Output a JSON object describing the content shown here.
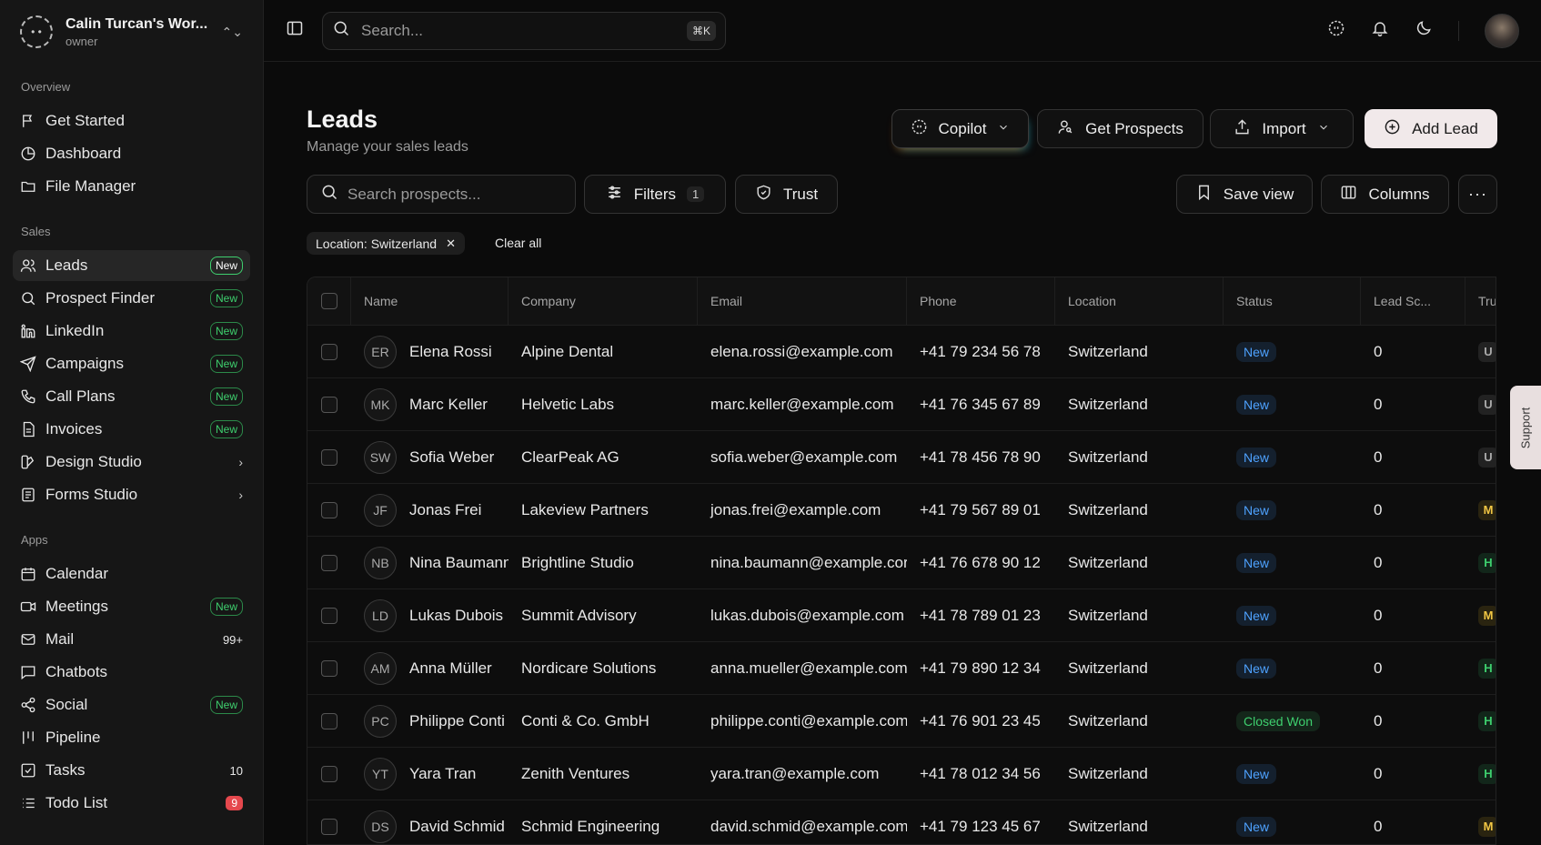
{
  "workspace": {
    "name": "Calin Turcan's Wor...",
    "role": "owner"
  },
  "sidebar": {
    "overview_label": "Overview",
    "overview": [
      {
        "label": "Get Started",
        "icon": "flag-icon"
      },
      {
        "label": "Dashboard",
        "icon": "pie-chart-icon"
      },
      {
        "label": "File Manager",
        "icon": "folder-icon"
      }
    ],
    "sales_label": "Sales",
    "sales": [
      {
        "label": "Leads",
        "badge": "New"
      },
      {
        "label": "Prospect Finder",
        "badge": "New"
      },
      {
        "label": "LinkedIn",
        "badge": "New"
      },
      {
        "label": "Campaigns",
        "badge": "New"
      },
      {
        "label": "Call Plans",
        "badge": "New"
      },
      {
        "label": "Invoices",
        "badge": "New"
      },
      {
        "label": "Design Studio"
      },
      {
        "label": "Forms Studio"
      }
    ],
    "apps_label": "Apps",
    "apps": [
      {
        "label": "Calendar"
      },
      {
        "label": "Meetings",
        "badge": "New"
      },
      {
        "label": "Mail",
        "count": "99+"
      },
      {
        "label": "Chatbots"
      },
      {
        "label": "Social",
        "badge": "New"
      },
      {
        "label": "Pipeline"
      },
      {
        "label": "Tasks",
        "count": "10"
      },
      {
        "label": "Todo List",
        "count": "9"
      }
    ]
  },
  "topbar": {
    "search_placeholder": "Search...",
    "shortcut": "⌘K"
  },
  "page": {
    "title": "Leads",
    "subtitle": "Manage your sales leads"
  },
  "actions": {
    "copilot": "Copilot",
    "get_prospects": "Get Prospects",
    "import": "Import",
    "add_lead": "Add Lead"
  },
  "toolbar": {
    "search_placeholder": "Search prospects...",
    "filters": "Filters",
    "filters_count": "1",
    "trust": "Trust",
    "save_view": "Save view",
    "columns": "Columns"
  },
  "active_filter": {
    "chip": "Location: Switzerland",
    "clear": "Clear all"
  },
  "table": {
    "columns": [
      "Name",
      "Company",
      "Email",
      "Phone",
      "Location",
      "Status",
      "Lead Sc...",
      "Tru"
    ],
    "rows": [
      {
        "initials": "ER",
        "name": "Elena Rossi",
        "company": "Alpine Dental",
        "email": "elena.rossi@example.com",
        "phone": "+41 79 234 56 78",
        "location": "Switzerland",
        "status": "New",
        "score": "0",
        "trust": "U"
      },
      {
        "initials": "MK",
        "name": "Marc Keller",
        "company": "Helvetic Labs",
        "email": "marc.keller@example.com",
        "phone": "+41 76 345 67 89",
        "location": "Switzerland",
        "status": "New",
        "score": "0",
        "trust": "U"
      },
      {
        "initials": "SW",
        "name": "Sofia Weber",
        "company": "ClearPeak AG",
        "email": "sofia.weber@example.com",
        "phone": "+41 78 456 78 90",
        "location": "Switzerland",
        "status": "New",
        "score": "0",
        "trust": "U"
      },
      {
        "initials": "JF",
        "name": "Jonas Frei",
        "company": "Lakeview Partners",
        "email": "jonas.frei@example.com",
        "phone": "+41 79 567 89 01",
        "location": "Switzerland",
        "status": "New",
        "score": "0",
        "trust": "M"
      },
      {
        "initials": "NB",
        "name": "Nina Baumann",
        "company": "Brightline Studio",
        "email": "nina.baumann@example.cor",
        "phone": "+41 76 678 90 12",
        "location": "Switzerland",
        "status": "New",
        "score": "0",
        "trust": "H"
      },
      {
        "initials": "LD",
        "name": "Lukas Dubois",
        "company": "Summit Advisory",
        "email": "lukas.dubois@example.com",
        "phone": "+41 78 789 01 23",
        "location": "Switzerland",
        "status": "New",
        "score": "0",
        "trust": "M"
      },
      {
        "initials": "AM",
        "name": "Anna Müller",
        "company": "Nordicare Solutions",
        "email": "anna.mueller@example.com",
        "phone": "+41 79 890 12 34",
        "location": "Switzerland",
        "status": "New",
        "score": "0",
        "trust": "H"
      },
      {
        "initials": "PC",
        "name": "Philippe Conti",
        "company": "Conti & Co. GmbH",
        "email": "philippe.conti@example.com",
        "phone": "+41 76 901 23 45",
        "location": "Switzerland",
        "status": "Closed Won",
        "score": "0",
        "trust": "H"
      },
      {
        "initials": "YT",
        "name": "Yara Tran",
        "company": "Zenith Ventures",
        "email": "yara.tran@example.com",
        "phone": "+41 78 012 34 56",
        "location": "Switzerland",
        "status": "New",
        "score": "0",
        "trust": "H"
      },
      {
        "initials": "DS",
        "name": "David Schmid",
        "company": "Schmid Engineering",
        "email": "david.schmid@example.com",
        "phone": "+41 79 123 45 67",
        "location": "Switzerland",
        "status": "New",
        "score": "0",
        "trust": "M"
      }
    ]
  },
  "support_label": "Support"
}
